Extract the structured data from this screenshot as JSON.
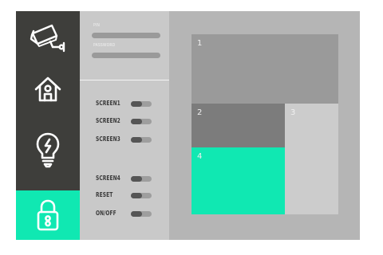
{
  "colors": {
    "sidebar": "#3e3e3b",
    "accent": "#10e8b2",
    "panel": "#c9c9c9",
    "screen_area": "#b5b5b5"
  },
  "sidebar": {
    "items": [
      {
        "icon": "cctv-camera-icon",
        "active": false
      },
      {
        "icon": "home-icon",
        "active": false
      },
      {
        "icon": "lightbulb-icon",
        "active": false
      },
      {
        "icon": "padlock-icon",
        "active": true
      }
    ]
  },
  "login": {
    "pin_label": "PIN",
    "password_label": "PASSWORD"
  },
  "controls": [
    {
      "label": "SCREEN1",
      "on": false
    },
    {
      "label": "SCREEN2",
      "on": false
    },
    {
      "label": "SCREEN3",
      "on": false
    },
    {
      "label": "SCREEN4",
      "on": false
    },
    {
      "label": "RESET",
      "on": false
    },
    {
      "label": "ON/OFF",
      "on": false
    }
  ],
  "screens": [
    {
      "number": "1",
      "color": "#9a9a9a"
    },
    {
      "number": "2",
      "color": "#7c7c7c"
    },
    {
      "number": "3",
      "color": "#cccccc"
    },
    {
      "number": "4",
      "color": "#10e8b2"
    }
  ]
}
